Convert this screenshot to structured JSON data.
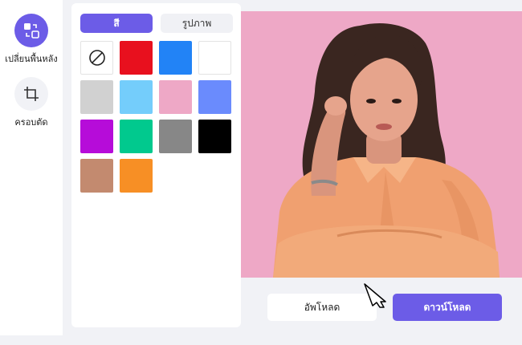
{
  "sidebar": {
    "tools": [
      {
        "label": "เปลี่ยนพื้นหลัง",
        "icon": "swap-background-icon",
        "active": true
      },
      {
        "label": "ครอบตัด",
        "icon": "crop-icon",
        "active": false
      }
    ]
  },
  "panel": {
    "tabs": [
      {
        "label": "สี",
        "active": true
      },
      {
        "label": "รูปภาพ",
        "active": false
      }
    ],
    "swatches": [
      {
        "name": "none",
        "color": "#ffffff"
      },
      {
        "name": "red",
        "color": "#e8101e"
      },
      {
        "name": "blue",
        "color": "#2283f6"
      },
      {
        "name": "white",
        "color": "#ffffff"
      },
      {
        "name": "light-gray",
        "color": "#d1d1d1"
      },
      {
        "name": "sky-blue",
        "color": "#74cdfb"
      },
      {
        "name": "pink",
        "color": "#eea8c6"
      },
      {
        "name": "periwinkle",
        "color": "#6a8bfd"
      },
      {
        "name": "purple",
        "color": "#b60cd9"
      },
      {
        "name": "green",
        "color": "#01c98e"
      },
      {
        "name": "gray",
        "color": "#878787"
      },
      {
        "name": "black",
        "color": "#000000"
      },
      {
        "name": "brown",
        "color": "#c38a6f"
      },
      {
        "name": "orange",
        "color": "#f78f25"
      }
    ]
  },
  "preview": {
    "background_color": "#eea8c6"
  },
  "actions": {
    "upload_label": "อัพโหลด",
    "download_label": "ดาวน์โหลด"
  },
  "theme": {
    "accent": "#6c5ce7"
  }
}
